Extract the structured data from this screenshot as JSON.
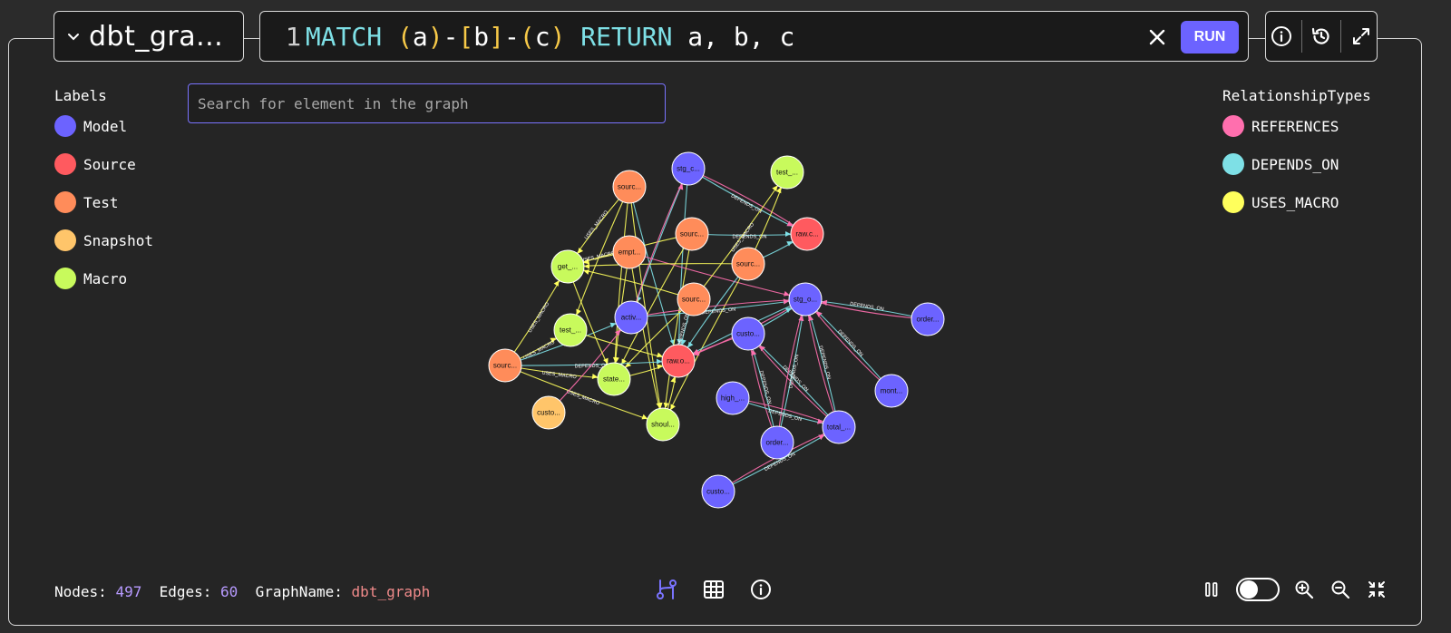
{
  "graph_selector": {
    "name": "dbt_gra..."
  },
  "query": {
    "line_number": "1",
    "tokens": [
      {
        "t": "MATCH ",
        "c": "kw"
      },
      {
        "t": "(",
        "c": "paren"
      },
      {
        "t": "a",
        "c": "ident"
      },
      {
        "t": ")",
        "c": "paren"
      },
      {
        "t": "-",
        "c": "ident"
      },
      {
        "t": "[",
        "c": "br"
      },
      {
        "t": "b",
        "c": "ident"
      },
      {
        "t": "]",
        "c": "br"
      },
      {
        "t": "-",
        "c": "ident"
      },
      {
        "t": "(",
        "c": "paren"
      },
      {
        "t": "c",
        "c": "ident"
      },
      {
        "t": ")",
        "c": "paren"
      },
      {
        "t": " RETURN ",
        "c": "kw"
      },
      {
        "t": "a, b, c",
        "c": "ident"
      }
    ],
    "run_label": "RUN"
  },
  "search": {
    "placeholder": "Search for element in the graph"
  },
  "labels": {
    "title": "Labels",
    "items": [
      {
        "label": "Model",
        "color": "#6c63ff"
      },
      {
        "label": "Source",
        "color": "#ff5a5f"
      },
      {
        "label": "Test",
        "color": "#ff8c5a"
      },
      {
        "label": "Snapshot",
        "color": "#ffc56a"
      },
      {
        "label": "Macro",
        "color": "#c8fa5c"
      }
    ]
  },
  "relationship_types": {
    "title": "RelationshipTypes",
    "items": [
      {
        "label": "REFERENCES",
        "color": "#ff6fae"
      },
      {
        "label": "DEPENDS_ON",
        "color": "#7ee0e6"
      },
      {
        "label": "USES_MACRO",
        "color": "#ffff5c"
      }
    ]
  },
  "graph": {
    "edge_label_text": {
      "DEPENDS_ON": "DEPENDS_ON",
      "USES_MACRO": "USES_MACRO"
    },
    "nodes": [
      {
        "id": "n1",
        "label": "stg_c...",
        "type": "Model"
      },
      {
        "id": "n2",
        "label": "test_...",
        "type": "Macro"
      },
      {
        "id": "n3",
        "label": "sourc...",
        "type": "Test"
      },
      {
        "id": "n4",
        "label": "raw.c...",
        "type": "Source"
      },
      {
        "id": "n5",
        "label": "sourc...",
        "type": "Test"
      },
      {
        "id": "n6",
        "label": "empt...",
        "type": "Test"
      },
      {
        "id": "n7",
        "label": "get_...",
        "type": "Macro"
      },
      {
        "id": "n8",
        "label": "sourc...",
        "type": "Test"
      },
      {
        "id": "n9",
        "label": "sourc...",
        "type": "Test"
      },
      {
        "id": "n10",
        "label": "stg_o...",
        "type": "Model"
      },
      {
        "id": "n11",
        "label": "order...",
        "type": "Model"
      },
      {
        "id": "n12",
        "label": "activ...",
        "type": "Model"
      },
      {
        "id": "n13",
        "label": "test_...",
        "type": "Macro"
      },
      {
        "id": "n14",
        "label": "custo...",
        "type": "Model"
      },
      {
        "id": "n15",
        "label": "raw.o...",
        "type": "Source"
      },
      {
        "id": "n16",
        "label": "sourc...",
        "type": "Test"
      },
      {
        "id": "n17",
        "label": "state...",
        "type": "Macro"
      },
      {
        "id": "n18",
        "label": "mont...",
        "type": "Model"
      },
      {
        "id": "n19",
        "label": "custo...",
        "type": "Snapshot"
      },
      {
        "id": "n20",
        "label": "high_...",
        "type": "Model"
      },
      {
        "id": "n21",
        "label": "shoul...",
        "type": "Macro"
      },
      {
        "id": "n22",
        "label": "total_...",
        "type": "Model"
      },
      {
        "id": "n23",
        "label": "order...",
        "type": "Model"
      },
      {
        "id": "n24",
        "label": "custo...",
        "type": "Model"
      }
    ],
    "edges": [
      {
        "s": "n1",
        "t": "n4",
        "type": "DEPENDS_ON",
        "label": true
      },
      {
        "s": "n1",
        "t": "n4",
        "type": "REFERENCES"
      },
      {
        "s": "n1",
        "t": "n12",
        "type": "DEPENDS_ON"
      },
      {
        "s": "n1",
        "t": "n15",
        "type": "DEPENDS_ON"
      },
      {
        "s": "n3",
        "t": "n7",
        "type": "USES_MACRO",
        "label": true
      },
      {
        "s": "n3",
        "t": "n13",
        "type": "USES_MACRO"
      },
      {
        "s": "n3",
        "t": "n17",
        "type": "USES_MACRO"
      },
      {
        "s": "n3",
        "t": "n21",
        "type": "USES_MACRO"
      },
      {
        "s": "n3",
        "t": "n15",
        "type": "DEPENDS_ON"
      },
      {
        "s": "n5",
        "t": "n4",
        "type": "DEPENDS_ON",
        "label": true
      },
      {
        "s": "n5",
        "t": "n7",
        "type": "USES_MACRO"
      },
      {
        "s": "n5",
        "t": "n17",
        "type": "USES_MACRO"
      },
      {
        "s": "n5",
        "t": "n21",
        "type": "USES_MACRO"
      },
      {
        "s": "n6",
        "t": "n7",
        "type": "USES_MACRO",
        "label": true
      },
      {
        "s": "n6",
        "t": "n21",
        "type": "USES_MACRO"
      },
      {
        "s": "n6",
        "t": "n10",
        "type": "REFERENCES"
      },
      {
        "s": "n6",
        "t": "n17",
        "type": "USES_MACRO"
      },
      {
        "s": "n8",
        "t": "n4",
        "type": "DEPENDS_ON"
      },
      {
        "s": "n8",
        "t": "n7",
        "type": "USES_MACRO"
      },
      {
        "s": "n8",
        "t": "n15",
        "type": "DEPENDS_ON"
      },
      {
        "s": "n8",
        "t": "n21",
        "type": "USES_MACRO"
      },
      {
        "s": "n8",
        "t": "n2",
        "type": "USES_MACRO"
      },
      {
        "s": "n9",
        "t": "n15",
        "type": "DEPENDS_ON",
        "label": true
      },
      {
        "s": "n9",
        "t": "n7",
        "type": "USES_MACRO"
      },
      {
        "s": "n9",
        "t": "n17",
        "type": "USES_MACRO"
      },
      {
        "s": "n9",
        "t": "n2",
        "type": "USES_MACRO",
        "label": true
      },
      {
        "s": "n12",
        "t": "n10",
        "type": "DEPENDS_ON",
        "label": true
      },
      {
        "s": "n12",
        "t": "n10",
        "type": "REFERENCES"
      },
      {
        "s": "n12",
        "t": "n1",
        "type": "REFERENCES"
      },
      {
        "s": "n16",
        "t": "n7",
        "type": "USES_MACRO",
        "label": true
      },
      {
        "s": "n16",
        "t": "n13",
        "type": "USES_MACRO",
        "label": true
      },
      {
        "s": "n16",
        "t": "n17",
        "type": "USES_MACRO",
        "label": true
      },
      {
        "s": "n16",
        "t": "n21",
        "type": "USES_MACRO",
        "label": true
      },
      {
        "s": "n16",
        "t": "n15",
        "type": "DEPENDS_ON",
        "label": true
      },
      {
        "s": "n16",
        "t": "n12",
        "type": "DEPENDS_ON"
      },
      {
        "s": "n19",
        "t": "n12",
        "type": "REFERENCES"
      },
      {
        "s": "n10",
        "t": "n15",
        "type": "DEPENDS_ON"
      },
      {
        "s": "n10",
        "t": "n15",
        "type": "REFERENCES"
      },
      {
        "s": "n11",
        "t": "n10",
        "type": "DEPENDS_ON",
        "label": true
      },
      {
        "s": "n11",
        "t": "n10",
        "type": "REFERENCES"
      },
      {
        "s": "n18",
        "t": "n10",
        "type": "DEPENDS_ON",
        "label": true
      },
      {
        "s": "n18",
        "t": "n10",
        "type": "REFERENCES"
      },
      {
        "s": "n14",
        "t": "n10",
        "type": "DEPENDS_ON"
      },
      {
        "s": "n14",
        "t": "n15",
        "type": "REFERENCES"
      },
      {
        "s": "n22",
        "t": "n10",
        "type": "DEPENDS_ON",
        "label": true
      },
      {
        "s": "n22",
        "t": "n10",
        "type": "REFERENCES"
      },
      {
        "s": "n22",
        "t": "n14",
        "type": "DEPENDS_ON",
        "label": true
      },
      {
        "s": "n22",
        "t": "n14",
        "type": "REFERENCES"
      },
      {
        "s": "n23",
        "t": "n10",
        "type": "DEPENDS_ON",
        "label": true
      },
      {
        "s": "n23",
        "t": "n10",
        "type": "REFERENCES"
      },
      {
        "s": "n23",
        "t": "n14",
        "type": "DEPENDS_ON",
        "label": true
      },
      {
        "s": "n23",
        "t": "n14",
        "type": "REFERENCES"
      },
      {
        "s": "n20",
        "t": "n22",
        "type": "DEPENDS_ON",
        "label": true
      },
      {
        "s": "n20",
        "t": "n22",
        "type": "REFERENCES"
      },
      {
        "s": "n24",
        "t": "n22",
        "type": "DEPENDS_ON",
        "label": true
      },
      {
        "s": "n24",
        "t": "n22",
        "type": "REFERENCES"
      },
      {
        "s": "n21",
        "t": "n15",
        "type": "USES_MACRO"
      },
      {
        "s": "n13",
        "t": "n15",
        "type": "USES_MACRO"
      },
      {
        "s": "n17",
        "t": "n15",
        "type": "USES_MACRO"
      },
      {
        "s": "n7",
        "t": "n17",
        "type": "USES_MACRO"
      }
    ]
  },
  "footer": {
    "nodes_key": "Nodes:",
    "nodes_value": "497",
    "edges_key": "Edges:",
    "edges_value": "60",
    "graphname_key": "GraphName:",
    "graphname_value": "dbt_graph"
  },
  "icons": {
    "graph_view": "graph-view-icon",
    "table_view": "table-view-icon",
    "info": "info-icon",
    "pause": "pause-icon",
    "zoom_in": "zoom-in-icon",
    "zoom_out": "zoom-out-icon",
    "fit": "collapse-icon",
    "history": "history-icon",
    "expand": "expand-icon"
  }
}
